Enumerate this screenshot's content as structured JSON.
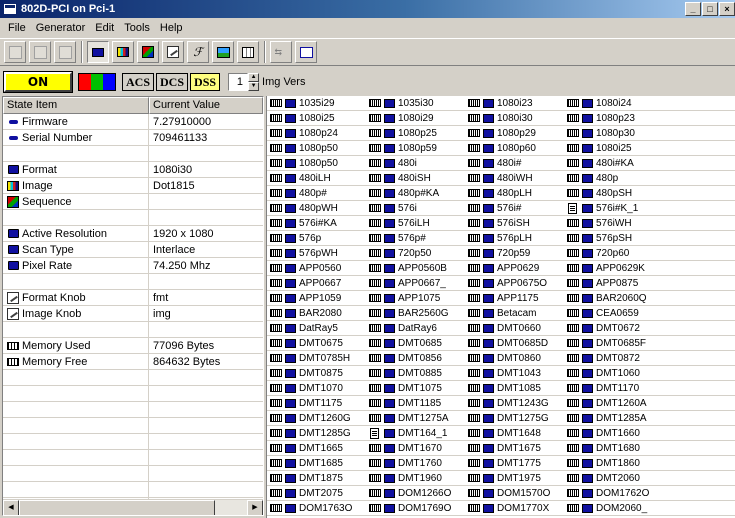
{
  "window": {
    "title": "802D-PCI on Pci-1",
    "buttons": [
      "_",
      "□",
      "×"
    ]
  },
  "menu": [
    "File",
    "Generator",
    "Edit",
    "Tools",
    "Help"
  ],
  "toolbar": {
    "icons": [
      "options-disabled-icon",
      "card-disabled-icon",
      "hand-disabled-icon",
      "format-icon",
      "image-icon",
      "sequence-icon",
      "knob-icon",
      "function-icon",
      "picture-icon",
      "grid-icon",
      "arrows-icon",
      "export-icon"
    ]
  },
  "controls": {
    "on_label": "ON",
    "rgb": [
      "#ff0000",
      "#00c000",
      "#0000ff"
    ],
    "modes": [
      "ACS",
      "DCS",
      "DSS"
    ],
    "active_mode": "DSS",
    "spin_value": "1",
    "spin_label": "Img Vers"
  },
  "state_table": {
    "headers": [
      "State Item",
      "Current Value"
    ],
    "rows": [
      {
        "icon": "pin",
        "item": "Firmware",
        "value": "7.27910000"
      },
      {
        "icon": "pin",
        "item": "Serial Number",
        "value": "709461133"
      },
      {
        "icon": "",
        "item": "",
        "value": ""
      },
      {
        "icon": "monitor",
        "item": "Format",
        "value": "1080i30"
      },
      {
        "icon": "bars",
        "item": "Image",
        "value": "Dot1815"
      },
      {
        "icon": "seq",
        "item": "Sequence",
        "value": ""
      },
      {
        "icon": "",
        "item": "",
        "value": ""
      },
      {
        "icon": "monitor",
        "item": "Active Resolution",
        "value": "1920 x 1080"
      },
      {
        "icon": "monitor",
        "item": "Scan Type",
        "value": "Interlace"
      },
      {
        "icon": "monitor",
        "item": "Pixel Rate",
        "value": "74.250 Mhz"
      },
      {
        "icon": "",
        "item": "",
        "value": ""
      },
      {
        "icon": "knob",
        "item": "Format Knob",
        "value": "fmt"
      },
      {
        "icon": "knob",
        "item": "Image Knob",
        "value": "img"
      },
      {
        "icon": "",
        "item": "",
        "value": ""
      },
      {
        "icon": "mem",
        "item": "Memory Used",
        "value": "77096 Bytes"
      },
      {
        "icon": "mem",
        "item": "Memory Free",
        "value": "864632 Bytes"
      },
      {
        "icon": "",
        "item": "",
        "value": ""
      },
      {
        "icon": "",
        "item": "",
        "value": ""
      },
      {
        "icon": "",
        "item": "",
        "value": ""
      },
      {
        "icon": "",
        "item": "",
        "value": ""
      },
      {
        "icon": "",
        "item": "",
        "value": ""
      },
      {
        "icon": "",
        "item": "",
        "value": ""
      },
      {
        "icon": "",
        "item": "",
        "value": ""
      },
      {
        "icon": "",
        "item": "",
        "value": ""
      },
      {
        "icon": "",
        "item": "",
        "value": ""
      }
    ]
  },
  "formats": [
    [
      "1035i29",
      "1035i30",
      "1080i23",
      "1080i24"
    ],
    [
      "1080i25",
      "1080i29",
      "1080i30",
      "1080p23"
    ],
    [
      "1080p24",
      "1080p25",
      "1080p29",
      "1080p30"
    ],
    [
      "1080p50",
      "1080p59",
      "1080p60",
      "1080i25"
    ],
    [
      "1080p50",
      "480i",
      "480i#",
      "480i#KA"
    ],
    [
      "480iLH",
      "480iSH",
      "480iWH",
      "480p"
    ],
    [
      "480p#",
      "480p#KA",
      "480pLH",
      "480pSH"
    ],
    [
      "480pWH",
      "576i",
      "576i#",
      "576i#K_1"
    ],
    [
      "576i#KA",
      "576iLH",
      "576iSH",
      "576iWH"
    ],
    [
      "576p",
      "576p#",
      "576pLH",
      "576pSH"
    ],
    [
      "576pWH",
      "720p50",
      "720p59",
      "720p60"
    ],
    [
      "APP0560",
      "APP0560B",
      "APP0629",
      "APP0629K"
    ],
    [
      "APP0667",
      "APP0667_",
      "APP0675O",
      "APP0875"
    ],
    [
      "APP1059",
      "APP1075",
      "APP1175",
      "BAR2060Q"
    ],
    [
      "BAR2080",
      "BAR2560G",
      "Betacam",
      "CEA0659"
    ],
    [
      "DatRay5",
      "DatRay6",
      "DMT0660",
      "DMT0672"
    ],
    [
      "DMT0675",
      "DMT0685",
      "DMT0685D",
      "DMT0685F"
    ],
    [
      "DMT0785H",
      "DMT0856",
      "DMT0860",
      "DMT0872"
    ],
    [
      "DMT0875",
      "DMT0885",
      "DMT1043",
      "DMT1060"
    ],
    [
      "DMT1070",
      "DMT1075",
      "DMT1085",
      "DMT1170"
    ],
    [
      "DMT1175",
      "DMT1185",
      "DMT1243G",
      "DMT1260A"
    ],
    [
      "DMT1260G",
      "DMT1275A",
      "DMT1275G",
      "DMT1285A"
    ],
    [
      "DMT1285G",
      "DMT164_1",
      "DMT1648",
      "DMT1660"
    ],
    [
      "DMT1665",
      "DMT1670",
      "DMT1675",
      "DMT1680"
    ],
    [
      "DMT1685",
      "DMT1760",
      "DMT1775",
      "DMT1860"
    ],
    [
      "DMT1875",
      "DMT1960",
      "DMT1975",
      "DMT2060"
    ],
    [
      "DMT2075",
      "DOM1266O",
      "DOM1570O",
      "DOM1762O"
    ],
    [
      "DOM1763O",
      "DOM1769O",
      "DOM1770X",
      "DOM2060_"
    ]
  ],
  "doc_icon_cells": [
    "7-3",
    "22-1"
  ]
}
